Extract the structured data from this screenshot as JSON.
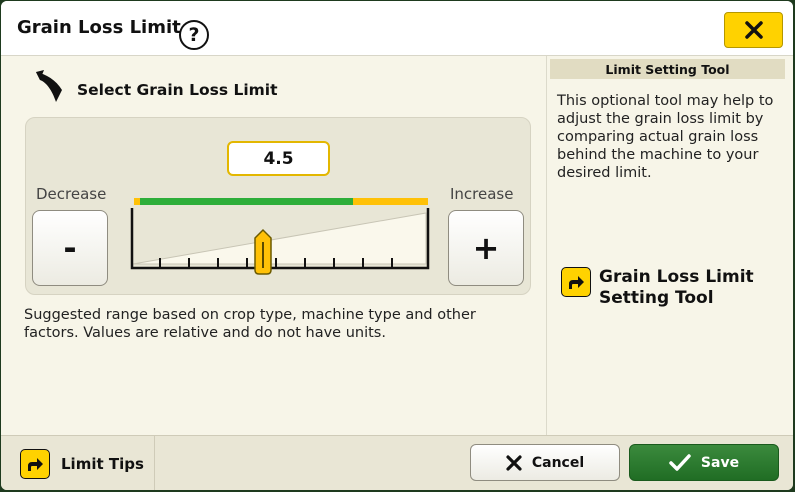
{
  "dialog": {
    "title": "Grain Loss Limit",
    "help_icon": "question-circle-icon",
    "close_icon": "close-icon",
    "accent_color": "#ffd200"
  },
  "left": {
    "heading": "Select Grain Loss Limit",
    "heading_icon": "combine-harvester-icon",
    "value": "4.5",
    "decrease_label": "Decrease",
    "increase_label": "Increase",
    "decrease_button": "-",
    "increase_button": "+",
    "suggested_range_colors": {
      "low": "#ffc107",
      "suggested": "#2eae3a",
      "high": "#ffc107"
    },
    "description": "Suggested range based on crop type, machine type and other factors. Values are relative and do not have units."
  },
  "right": {
    "header": "Limit Setting Tool",
    "description": "This optional tool may help to adjust the grain loss limit by comparing actual grain loss behind the machine to your desired limit.",
    "link_label": "Grain Loss Limit Setting Tool",
    "link_icon": "arrow-right-icon"
  },
  "footer": {
    "tips_label": "Limit Tips",
    "cancel_label": "Cancel",
    "save_label": "Save",
    "save_color": "#2a7d2e"
  }
}
